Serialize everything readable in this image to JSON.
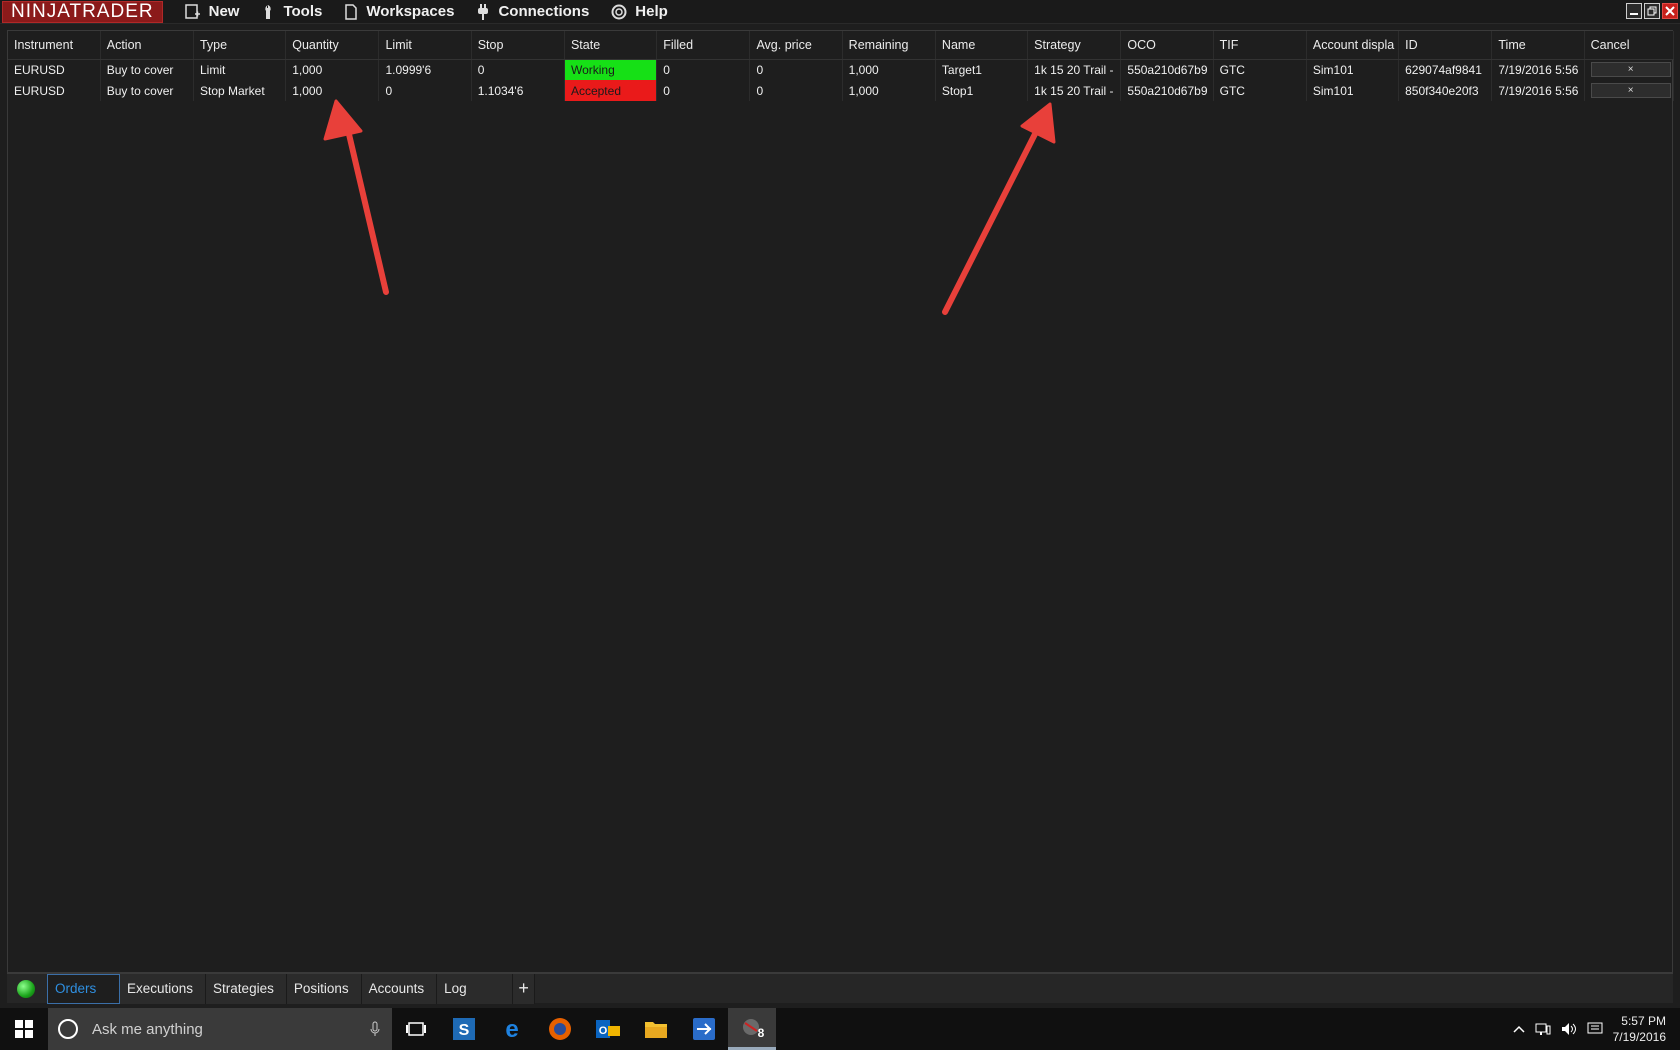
{
  "app": {
    "logo": "NINJATRADER"
  },
  "menu": [
    {
      "label": "New",
      "icon": "new-icon"
    },
    {
      "label": "Tools",
      "icon": "wrench-icon"
    },
    {
      "label": "Workspaces",
      "icon": "document-icon"
    },
    {
      "label": "Connections",
      "icon": "plug-icon"
    },
    {
      "label": "Help",
      "icon": "lifebuoy-icon"
    }
  ],
  "columns": [
    "Instrument",
    "Action",
    "Type",
    "Quantity",
    "Limit",
    "Stop",
    "State",
    "Filled",
    "Avg. price",
    "Remaining",
    "Name",
    "Strategy",
    "OCO",
    "TIF",
    "Account displa",
    "ID",
    "Time",
    "Cancel"
  ],
  "orders": [
    {
      "instrument": "EURUSD",
      "action": "Buy to cover",
      "type": "Limit",
      "quantity": "1,000",
      "limit": "1.0999'6",
      "stop": "0",
      "state": "Working",
      "filled": "0",
      "avg_price": "0",
      "remaining": "1,000",
      "name": "Target1",
      "strategy": "1k 15 20 Trail -",
      "oco": "550a210d67b9",
      "tif": "GTC",
      "account": "Sim101",
      "id": "629074af9841",
      "time": "7/19/2016 5:56",
      "cancel": "×"
    },
    {
      "instrument": "EURUSD",
      "action": "Buy to cover",
      "type": "Stop Market",
      "quantity": "1,000",
      "limit": "0",
      "stop": "1.1034'6",
      "state": "Accepted",
      "filled": "0",
      "avg_price": "0",
      "remaining": "1,000",
      "name": "Stop1",
      "strategy": "1k 15 20 Trail -",
      "oco": "550a210d67b9",
      "tif": "GTC",
      "account": "Sim101",
      "id": "850f340e20f3",
      "time": "7/19/2016 5:56",
      "cancel": "×"
    }
  ],
  "colors": {
    "working": "#16e016",
    "accepted": "#ea1a1a",
    "arrow": "#e8403a",
    "active_tab": "#2f8fe0"
  },
  "tabs": [
    {
      "label": "Orders",
      "active": true
    },
    {
      "label": "Executions"
    },
    {
      "label": "Strategies"
    },
    {
      "label": "Positions"
    },
    {
      "label": "Accounts"
    },
    {
      "label": "Log"
    },
    {
      "label": "+"
    }
  ],
  "taskbar": {
    "search_placeholder": "Ask me anything",
    "time": "5:57 PM",
    "date": "7/19/2016",
    "pinned": [
      "task-view-icon",
      "skype-icon",
      "edge-icon",
      "firefox-icon",
      "outlook-icon",
      "file-explorer-icon",
      "teamviewer-icon",
      "ninjatrader-icon"
    ],
    "ninjatrader_badge": "8"
  }
}
